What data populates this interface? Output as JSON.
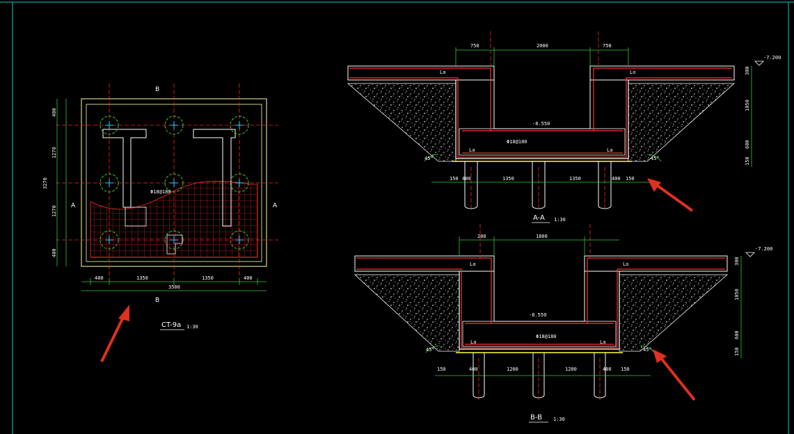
{
  "plan": {
    "title": "CT-9a",
    "scale": "1:30",
    "label_A": "A",
    "label_B": "B",
    "dims_bottom": [
      "400",
      "1350",
      "1350",
      "400"
    ],
    "dim_total_bottom": "3500",
    "dims_left": [
      "400",
      "1270",
      "1270",
      "400"
    ],
    "dim_total_left": "3270"
  },
  "section_a": {
    "title": "A-A",
    "scale": "1:30",
    "dims_top": [
      "750",
      "2000",
      "750"
    ],
    "dims_bottom": [
      "150",
      "400",
      "1350",
      "1350",
      "400",
      "150"
    ],
    "dims_right": [
      "300",
      "1050",
      "600",
      "150"
    ],
    "elevation": "-7.200",
    "inner_elevation": "-8.550",
    "rebar_label": "Φ18@180",
    "angle": "45°"
  },
  "section_b": {
    "title": "B-B",
    "scale": "1:30",
    "dims_top": [
      "200",
      "1800"
    ],
    "dims_bottom": [
      "150",
      "400",
      "1200",
      "1200",
      "400",
      "150"
    ],
    "dims_right": [
      "300",
      "1050",
      "600",
      "150"
    ],
    "elevation": "-7.200",
    "inner_elevation": "-8.550",
    "rebar_label": "Φ18@180",
    "angle": "45°"
  },
  "labels": {
    "la": "La",
    "lo": "Lo"
  },
  "colors": {
    "frame": "#00cccc",
    "wall": "#ff3333",
    "grid": "#cc2222",
    "dim": "#33cc33",
    "axis": "#ff2222",
    "pile": "#33cc33",
    "text": "#ffffff",
    "yellow": "#ffff33",
    "arrow": "#e03020",
    "soil": "#dddddd"
  }
}
